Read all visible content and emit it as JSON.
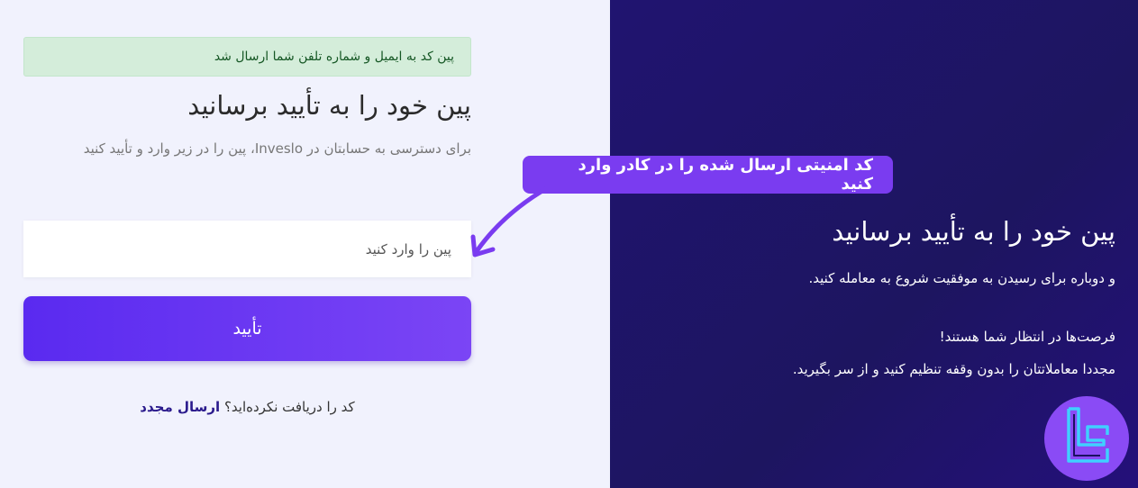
{
  "alert": {
    "text": "پین کد به ایمیل و شماره تلفن شما ارسال شد"
  },
  "form": {
    "title": "پین خود را به تأیید برسانید",
    "subtitle": "برای دسترسی به حسابتان در Inveslo، پین را در زیر وارد و تأیید کنید",
    "pin_placeholder": "پین را وارد کنید",
    "pin_value": "",
    "confirm_label": "تأیید",
    "resend_prompt": "کد را دریافت نکرده‌اید؟",
    "resend_link": "ارسال مجدد"
  },
  "callout": {
    "text": "کد امنیتی ارسال شده را در کادر وارد کنید"
  },
  "promo": {
    "title": "پین خود را به تأیید برسانید",
    "line1": "و دوباره برای رسیدن به موفقیت شروع به معامله کنید.",
    "line2": "فرصت‌ها در انتظار شما هستند!",
    "line3": "مجددا معاملاتتان را بدون وقفه تنظیم کنید و از سر بگیرید."
  },
  "colors": {
    "accent": "#6a35f3",
    "panel_dark": "#1d1560",
    "alert_bg": "#d4edda",
    "callout_bg": "#7a3cf0",
    "logo_bg": "#8a4bf5",
    "logo_stroke": "#3fd0ff"
  },
  "icons": {
    "arrow": "curved-arrow-icon",
    "logo": "brand-logo-icon"
  }
}
